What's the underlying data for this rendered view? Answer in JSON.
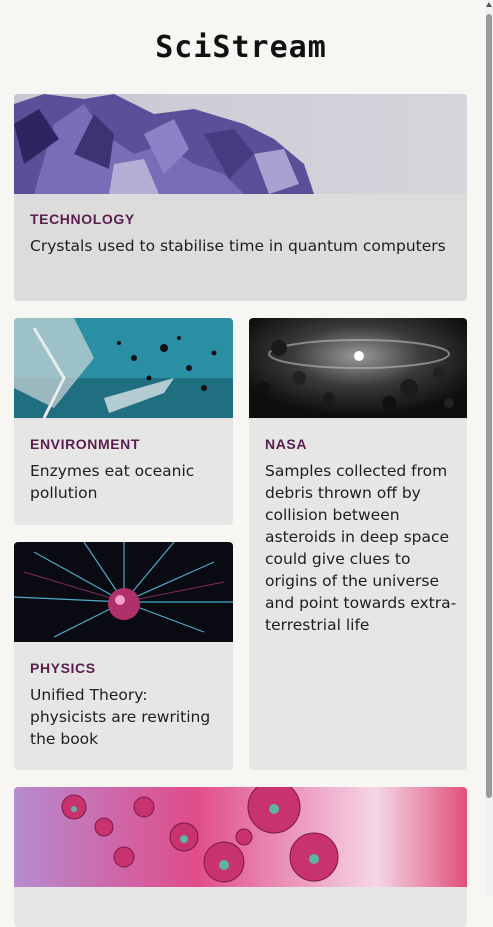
{
  "site": {
    "title": "SciStream"
  },
  "articles": [
    {
      "category": "TECHNOLOGY",
      "headline": "Crystals used to stabilise time in quantum computers",
      "image_icon": "amethyst-crystal-image"
    },
    {
      "category": "ENVIRONMENT",
      "headline": "Enzymes eat oceanic pollution",
      "image_icon": "ocean-plastic-image"
    },
    {
      "category": "NASA",
      "headline": "Samples collected from debris thrown off by collision between asteroids in deep space could give clues to origins of the universe and point towards extra-terrestrial life",
      "image_icon": "asteroid-field-image"
    },
    {
      "category": "PHYSICS",
      "headline": "Unified Theory: physicists are rewriting the book",
      "image_icon": "plasma-ball-image"
    },
    {
      "category": "",
      "headline": "",
      "image_icon": "pink-bubbles-image"
    }
  ],
  "colors": {
    "category": "#5a1d4e",
    "card": "#e6e6e6",
    "background": "#f8f6f3"
  }
}
